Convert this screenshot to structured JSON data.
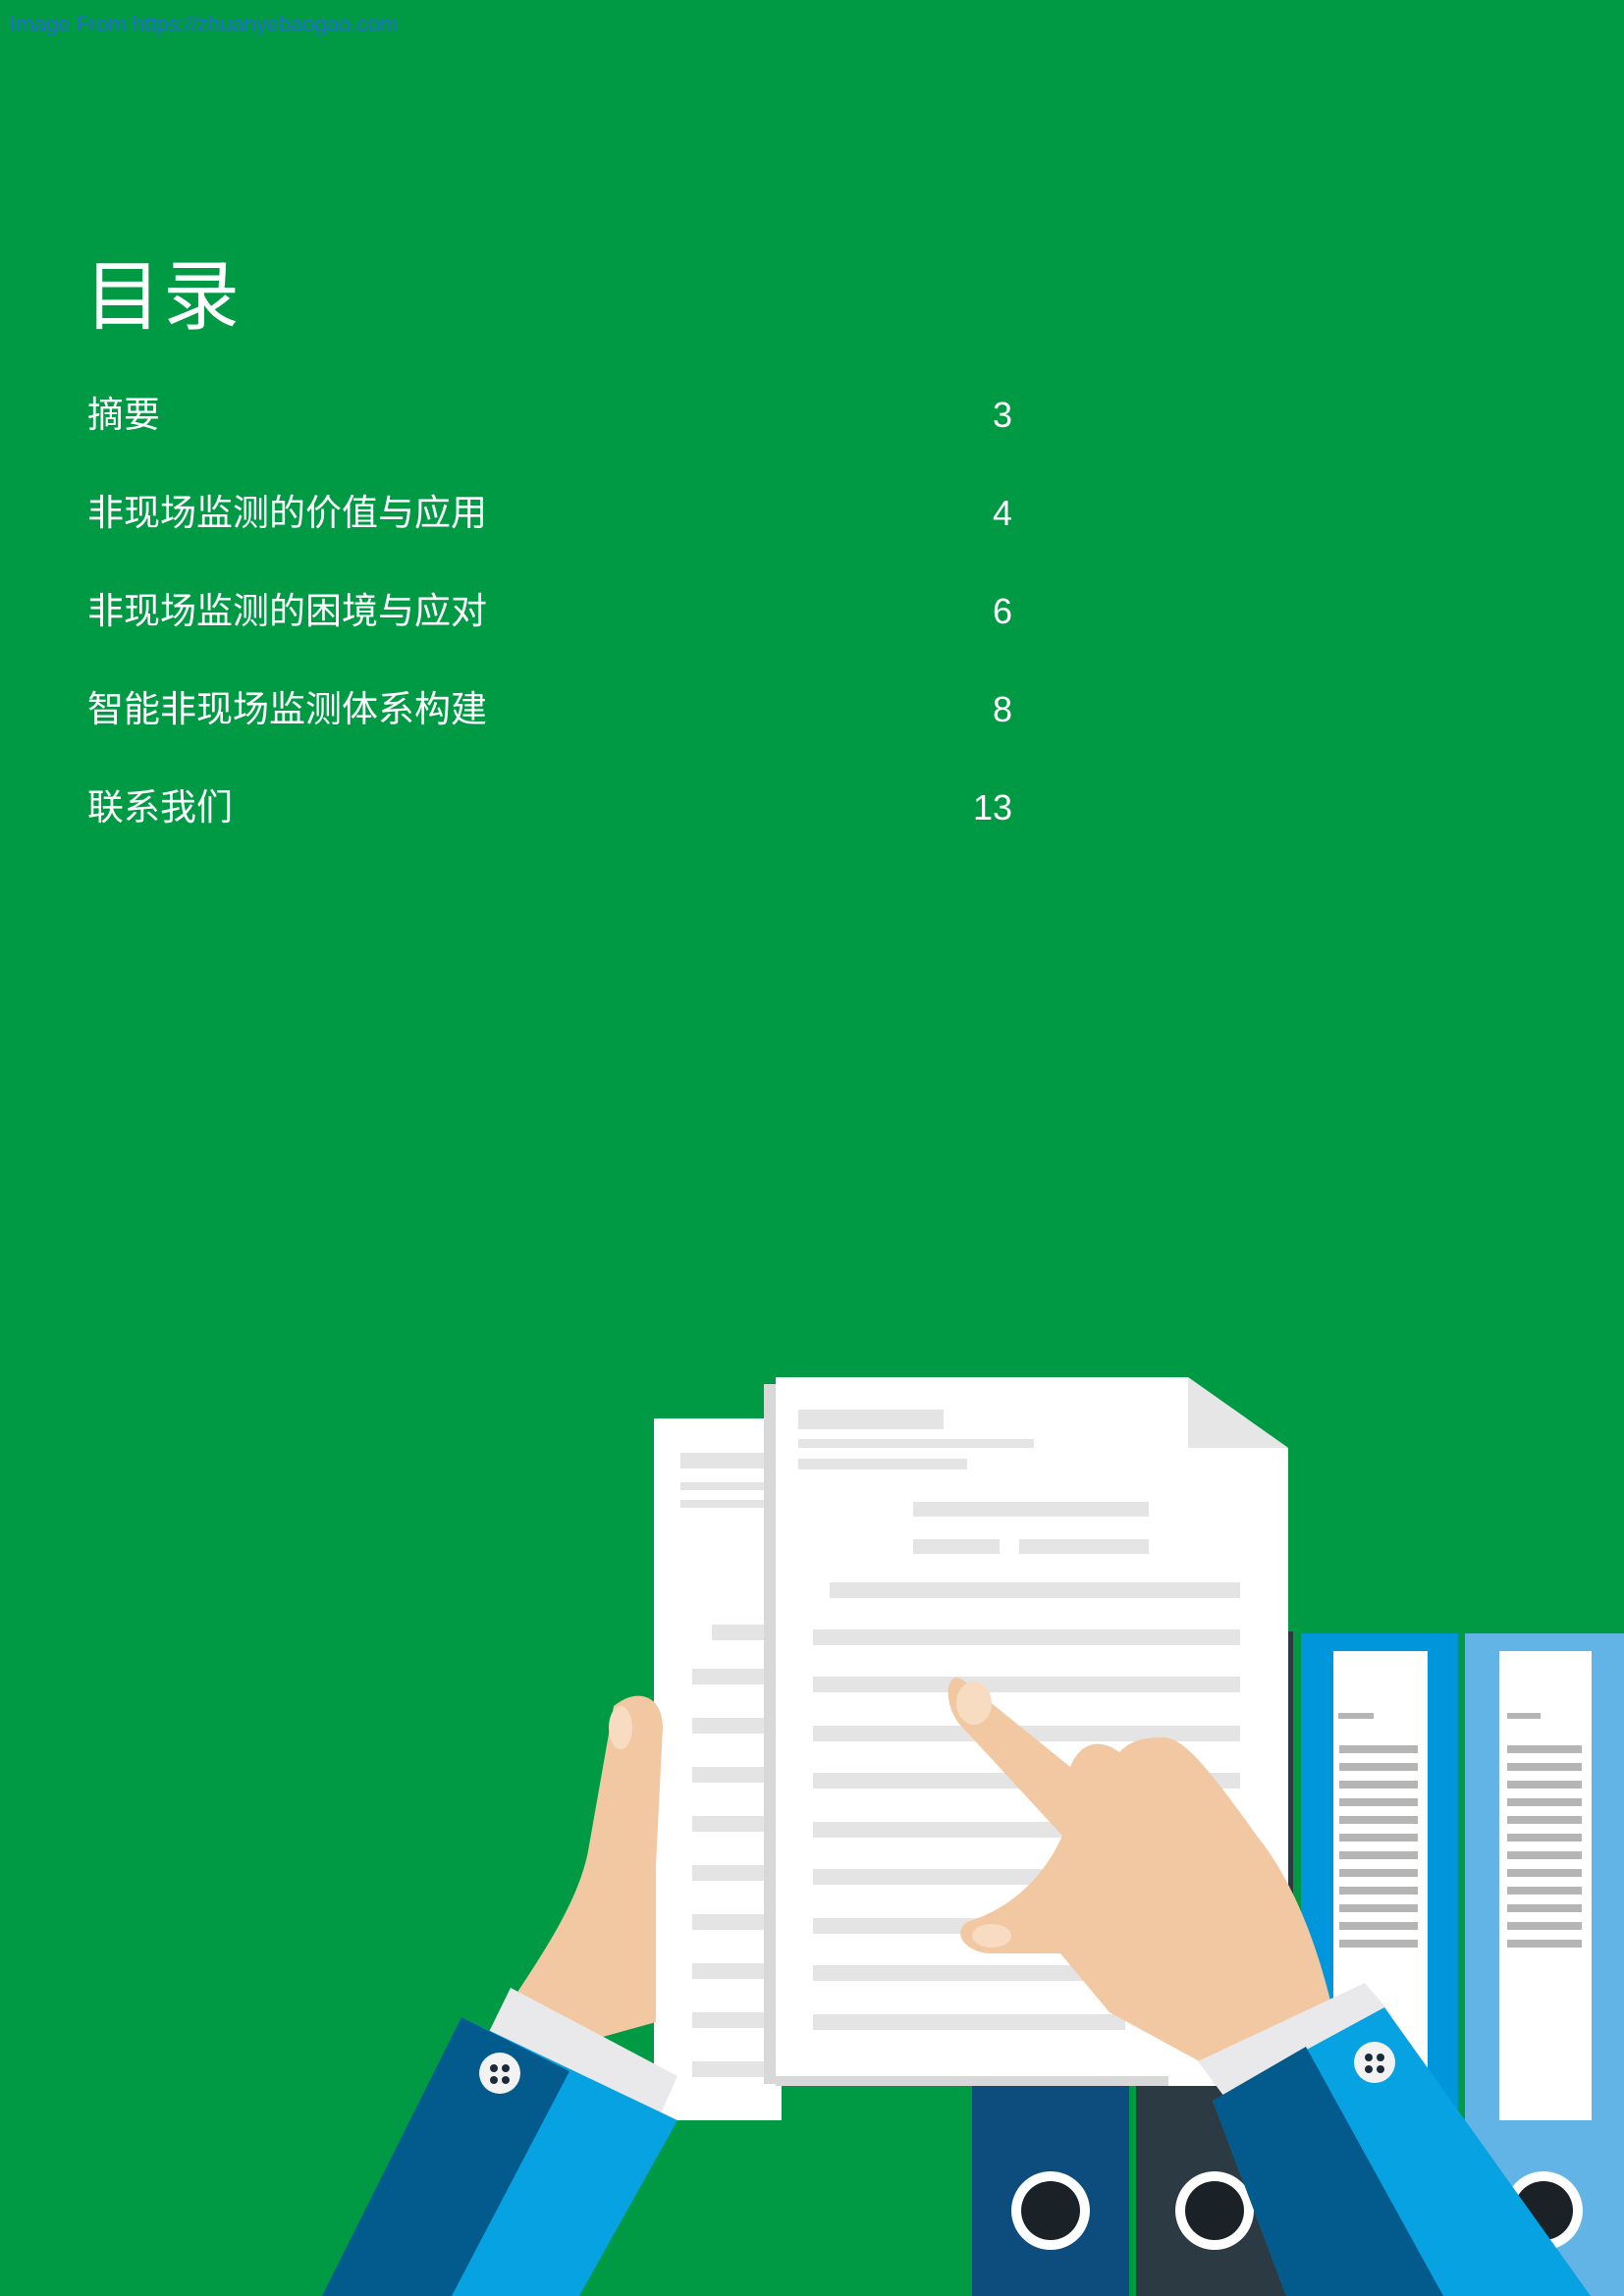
{
  "watermark": "Image From https://zhuanyebaogao.com",
  "toc": {
    "title": "目录",
    "items": [
      {
        "label": "摘要",
        "page": "3"
      },
      {
        "label": "非现场监测的价值与应用",
        "page": "4"
      },
      {
        "label": "非现场监测的困境与应对",
        "page": "6"
      },
      {
        "label": "智能非现场监测体系构建",
        "page": "8"
      },
      {
        "label": "联系我们",
        "page": "13"
      }
    ]
  },
  "colors": {
    "background": "#009a44",
    "paper": "#ffffff",
    "skin": "#f1c8a2",
    "sleeve_dark": "#035a8c",
    "sleeve_light": "#06a2e2",
    "binder_blue": "#0096db",
    "binder_light": "#62b4e6",
    "binder_navy": "#0d4d7e",
    "binder_charcoal": "#2c3a44"
  }
}
